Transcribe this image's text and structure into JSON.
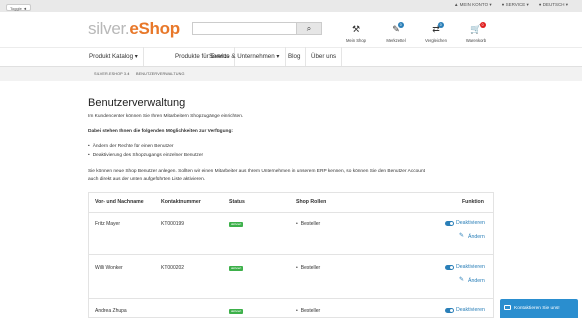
{
  "topbar": {
    "toggle_label": "Toggle ◄",
    "links": [
      "▲ MEIN KONTO ▾",
      "● SERVICE ▾",
      "● DEUTSCH ▾"
    ]
  },
  "header": {
    "logo_part1": "silver.",
    "logo_part2": "eShop",
    "search": {
      "value": "",
      "button_glyph": "⌕"
    },
    "icons": [
      {
        "name": "main-shop",
        "glyph": "⚒",
        "label": "Mein Shop",
        "badge": ""
      },
      {
        "name": "merkzettel",
        "glyph": "✎",
        "label": "Merkzettel",
        "badge": "0"
      },
      {
        "name": "vergleichen",
        "glyph": "⇄",
        "label": "Vergleichen",
        "badge": "0"
      },
      {
        "name": "warenkorb",
        "glyph": "🛒",
        "label": "Warenkorb",
        "badge": "0"
      }
    ]
  },
  "nav": {
    "items": [
      "Produkt Katalog ▾",
      "Produkte für Events",
      "Service & Unternehmen ▾",
      "Blog",
      "Über uns"
    ]
  },
  "breadcrumb": {
    "items": [
      "SILVER.ESHOP 3.4",
      "BENUTZERVERWALTUNG"
    ]
  },
  "main": {
    "title": "Benutzerverwaltung",
    "intro": "Im Kundencenter können Sie Ihren Mitarbeitern Shopzugänge einrichten.",
    "options_heading": "Dabei stehen Ihnen die folgenden Möglichkeiten zur Verfügung:",
    "bullets": [
      "Ändern der Rechte für einen Benutzer",
      "Deaktivierung des Shopzugangs einzelner Benutzer"
    ],
    "para_line1": "Sie können neue Shop Benutzer anlegen. Sollten wir einen Mitarbeiter aus Ihrem Unternehmen in unserem ERP kennen, so können Sie den Benutzer Account",
    "para_line2": "auch direkt aus der unten aufgeführten Liste aktivieren."
  },
  "table": {
    "headers": [
      "Vor- und Nachname",
      "Kontaktnummer",
      "Status",
      "Shop Rollen",
      "Funktion"
    ],
    "rows": [
      {
        "name": "Fritz Mayer",
        "number": "KT000199",
        "status": "aktiviert",
        "role": "Besteller",
        "action1": "Deaktivieren",
        "action2": "Ändern"
      },
      {
        "name": "Willi Wonker",
        "number": "KT000202",
        "status": "aktiviert",
        "role": "Besteller",
        "action1": "Deaktivieren",
        "action2": "Ändern"
      },
      {
        "name": "Andrea Zhupa",
        "number": "",
        "status": "aktiviert",
        "role": "Besteller",
        "action1": "Deaktivieren",
        "action2": ""
      }
    ]
  },
  "chat": {
    "label": "Kontaktieren Sie uns!"
  },
  "colors": {
    "accent_orange": "#e8782a",
    "link_blue": "#2a7fb8",
    "status_green": "#3db04a"
  }
}
